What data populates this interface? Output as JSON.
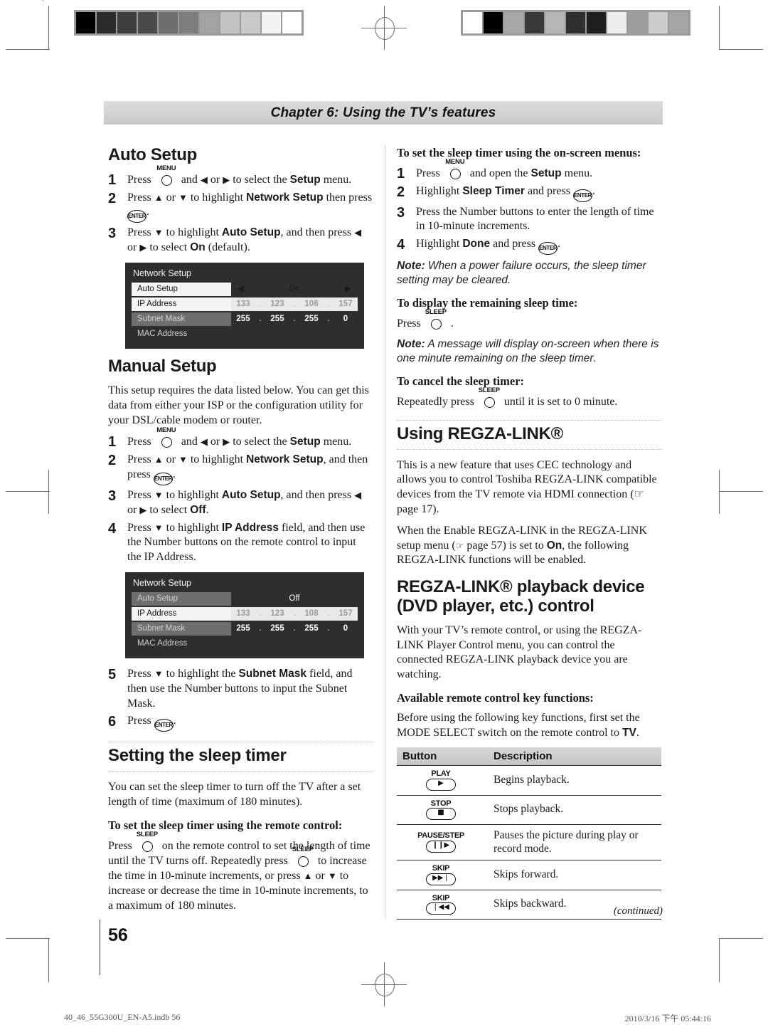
{
  "header": {
    "chapter_title": "Chapter 6: Using the TV’s features"
  },
  "left": {
    "auto_setup": {
      "heading": "Auto Setup",
      "steps": [
        {
          "num": "1",
          "html": "Press <key:MENU> and <arw>◀</arw> or <arw>▶</arw> to select the <ui>Setup</ui> menu."
        },
        {
          "num": "2",
          "html": "Press <arw>▲</arw> or <arw>▼</arw> to highlight <ui>Network Setup</ui> then press <enter>."
        },
        {
          "num": "3",
          "html": "Press <arw>▼</arw> to highlight <ui>Auto Setup</ui>, and then press <arw>◀</arw> or <arw>▶</arw> to select <ui>On</ui> (default)."
        }
      ]
    },
    "osd1": {
      "title": "Network Setup",
      "rows": [
        {
          "label": "Auto Setup",
          "value": "On",
          "arrows": true
        },
        {
          "label": "IP Address",
          "octets": [
            "133",
            "123",
            "108",
            "157"
          ]
        },
        {
          "label": "Subnet Mask",
          "octets": [
            "255",
            "255",
            "255",
            "0"
          ]
        },
        {
          "label": "MAC Address",
          "value": ""
        }
      ]
    },
    "manual_setup": {
      "heading": "Manual Setup",
      "intro": "This setup requires the data listed below. You can get this data from either your ISP or the configuration utility for your DSL/cable modem or router.",
      "steps": [
        {
          "num": "1",
          "html": "Press <key:MENU> and <arw>◀</arw> or <arw>▶</arw> to select the <ui>Setup</ui> menu."
        },
        {
          "num": "2",
          "html": "Press <arw>▲</arw> or <arw>▼</arw> to highlight <ui>Network Setup</ui>, and then press <enter>."
        },
        {
          "num": "3",
          "html": "Press <arw>▼</arw> to highlight <ui>Auto Setup</ui>, and then press <arw>◀</arw> or <arw>▶</arw> to select <ui>Off</ui>."
        },
        {
          "num": "4",
          "html": "Press <arw>▼</arw> to highlight <ui>IP Address</ui> field, and then use the Number buttons on the remote control to input the IP Address."
        }
      ],
      "steps_after": [
        {
          "num": "5",
          "html": "Press <arw>▼</arw> to highlight the <ui>Subnet Mask</ui> field, and then use the Number buttons to input the Subnet Mask."
        },
        {
          "num": "6",
          "html": "Press <enter>."
        }
      ]
    },
    "osd2": {
      "title": "Network Setup",
      "rows": [
        {
          "label": "Auto Setup",
          "value": "Off"
        },
        {
          "label": "IP Address",
          "octets": [
            "133",
            "123",
            "108",
            "157"
          ]
        },
        {
          "label": "Subnet Mask",
          "octets": [
            "255",
            "255",
            "255",
            "0"
          ]
        },
        {
          "label": "MAC Address",
          "value": ""
        }
      ]
    },
    "sleep_timer": {
      "heading": "Setting the sleep timer",
      "intro": "You can set the sleep timer to turn off the TV after a set length of time (maximum of 180 minutes).",
      "sub_remote": "To set the sleep timer using the remote control:",
      "remote_body": "Press <key:SLEEP> on the remote control to set the length of time until the TV turns off. Repeatedly press <key:SLEEP> to increase the time in 10-minute increments, or press <arw>▲</arw> or <arw>▼</arw> to increase or decrease the time in 10-minute increments, to a maximum of 180 minutes."
    }
  },
  "right": {
    "osm": {
      "sub": "To set the sleep timer using the on-screen menus:",
      "steps": [
        {
          "num": "1",
          "html": "Press <key:MENU> and open the <ui>Setup</ui> menu."
        },
        {
          "num": "2",
          "html": "Highlight <ui>Sleep Timer</ui> and press <enter>."
        },
        {
          "num": "3",
          "html": "Press the Number buttons to enter the length of time in 10-minute increments."
        },
        {
          "num": "4",
          "html": "Highlight <ui>Done</ui> and press <enter>."
        }
      ],
      "note_label": "Note:",
      "note_text": "When a power failure occurs, the sleep timer setting may be cleared."
    },
    "display_remaining": {
      "sub": "To display the remaining sleep time:",
      "body": "Press <key:SLEEP> .",
      "note_label": "Note:",
      "note_text": "A message will display on-screen when there is one minute remaining on the sleep timer."
    },
    "cancel": {
      "sub": "To cancel the sleep timer:",
      "body": "Repeatedly press <key:SLEEP> until it is set to 0 minute."
    },
    "regza": {
      "heading": "Using REGZA-LINK®",
      "p1": "This is a new feature that uses CEC technology and allows you to control Toshiba REGZA-LINK compatible devices from the TV remote via HDMI connection (☞ page 17).",
      "p2": "When the Enable REGZA-LINK in the REGZA-LINK setup menu (☞ page 57) is set to <ui>On</ui>, the following REGZA-LINK functions will be enabled."
    },
    "playback": {
      "heading": "REGZA-LINK® playback device (DVD player, etc.) control",
      "p1": "With your TV’s remote control, or using the REGZA-LINK Player Control menu, you can control the connected REGZA-LINK playback device you are watching.",
      "sub": "Available remote control key functions:",
      "p2": "Before using the following key functions, first set the MODE SELECT switch on the remote control to <ui>TV</ui>."
    },
    "button_table": {
      "headers": [
        "Button",
        "Description"
      ],
      "rows": [
        {
          "name": "PLAY",
          "glyph": "▶",
          "icon": "play-icon",
          "desc": "Begins playback."
        },
        {
          "name": "STOP",
          "glyph": "■",
          "icon": "stop-icon",
          "desc": "Stops playback."
        },
        {
          "name": "PAUSE/STEP",
          "glyph": "❙❙▶",
          "icon": "pause-step-icon",
          "desc": "Pauses the picture during play or record mode."
        },
        {
          "name": "SKIP",
          "glyph": "▶▶❘",
          "icon": "skip-forward-icon",
          "desc": "Skips forward."
        },
        {
          "name": "SKIP",
          "glyph": "❘◀◀",
          "icon": "skip-backward-icon",
          "desc": "Skips backward."
        }
      ]
    }
  },
  "footer": {
    "continued": "(continued)",
    "page_number": "56",
    "file_name": "40_46_55G300U_EN-A5.indb   56",
    "timestamp": "2010/3/16   下午 05:44:16"
  },
  "calibration": {
    "left_patches": [
      "#000000",
      "#2b2b2b",
      "#3d3d3d",
      "#4a4a4a",
      "#6e6e6e",
      "#7d7d7d",
      "#a3a3a3",
      "#c2c2c2",
      "#c9c9c9",
      "#f2f2f2",
      "#ffffff"
    ],
    "right_patches": [
      "#ffffff",
      "#000000",
      "#a8a8a8",
      "#3a3a3a",
      "#b6b6b6",
      "#2f2f2f",
      "#1f1f1f",
      "#ededed",
      "#9d9d9d",
      "#cdcdcd",
      "#a5a5a5"
    ]
  }
}
